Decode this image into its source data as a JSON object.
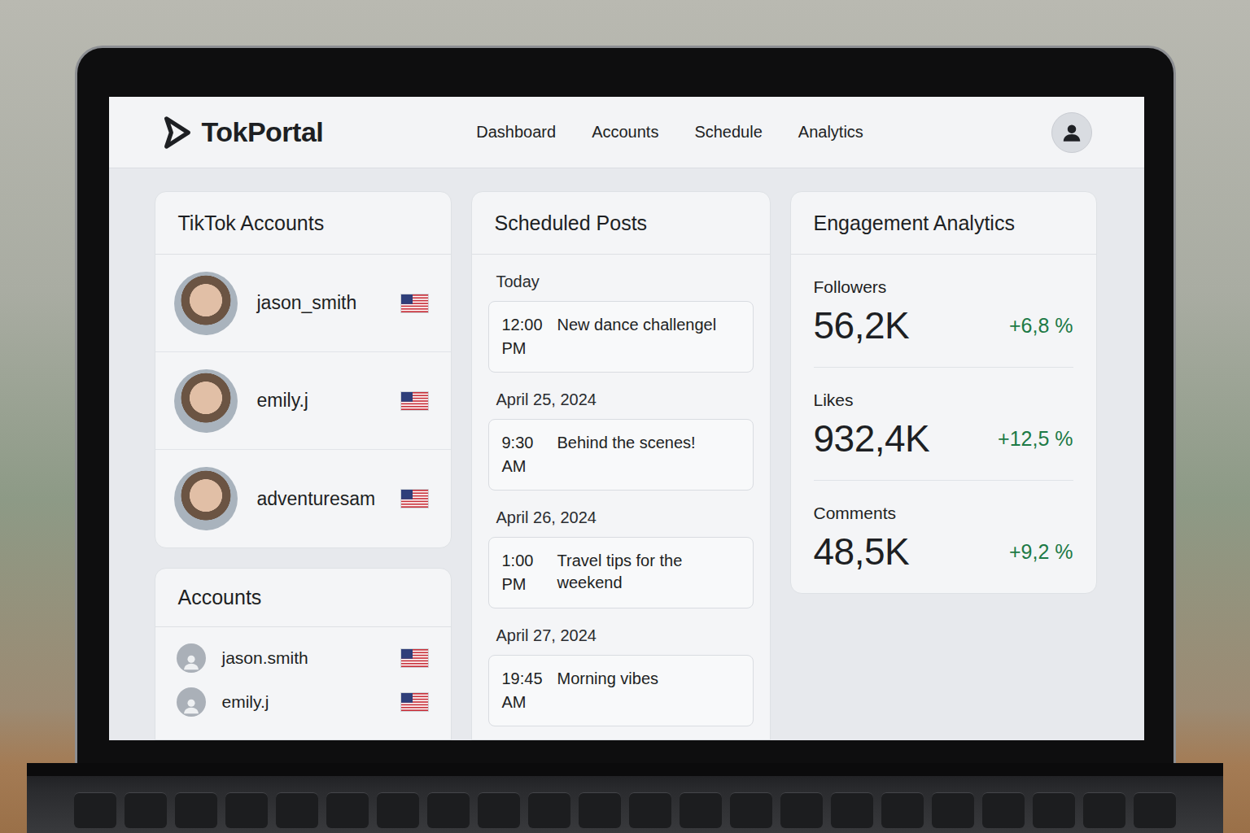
{
  "app": {
    "logo": "TokPortal"
  },
  "nav": [
    {
      "label": "Dashboard",
      "selected": false
    },
    {
      "label": "Accounts",
      "selected": false
    },
    {
      "label": "Schedule",
      "selected": false
    },
    {
      "label": "Analytics",
      "selected": false
    }
  ],
  "tiktok_accounts": {
    "title": "TikTok Accounts",
    "items": [
      {
        "name": "jason_smith"
      },
      {
        "name": "emily.j"
      },
      {
        "name": "adventuresam"
      }
    ]
  },
  "accounts": {
    "title": "Accounts",
    "items": [
      {
        "name": "jason.smith"
      },
      {
        "name": "emily.j"
      }
    ]
  },
  "scheduled": {
    "title": "Scheduled Posts",
    "groups": [
      {
        "label": "Today",
        "posts": [
          {
            "time": "12:00",
            "meridiem": "PM",
            "title": "New dance challengel"
          }
        ]
      },
      {
        "label": "April 25, 2024",
        "posts": [
          {
            "time": "9:30",
            "meridiem": "AM",
            "title": "Behind the scenes!"
          }
        ]
      },
      {
        "label": "April 26, 2024",
        "posts": [
          {
            "time": "1:00",
            "meridiem": "PM",
            "title": "Travel tips for the weekend"
          }
        ]
      },
      {
        "label": "April 27, 2024",
        "posts": [
          {
            "time": "19:45",
            "meridiem": "AM",
            "title": "Morning vibes"
          }
        ]
      }
    ]
  },
  "analytics": {
    "title": "Engagement Analytics",
    "stats": [
      {
        "label": "Followers",
        "value": "56,2K",
        "change": "+6,8 %"
      },
      {
        "label": "Likes",
        "value": "932,4K",
        "change": "+12,5 %"
      },
      {
        "label": "Comments",
        "value": "48,5K",
        "change": "+9,2 %"
      }
    ]
  }
}
